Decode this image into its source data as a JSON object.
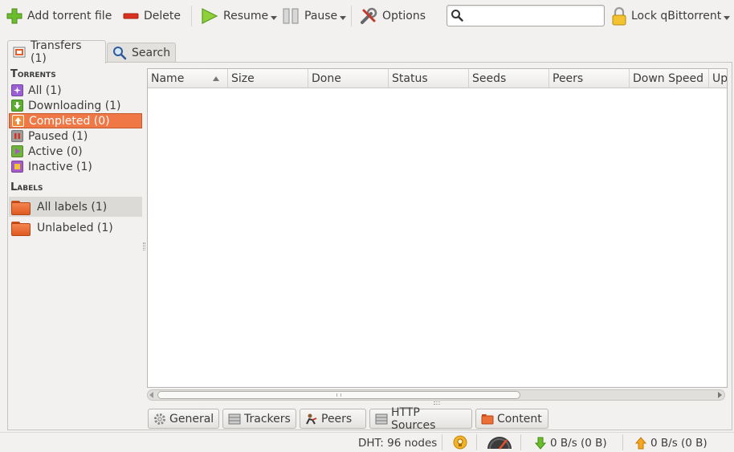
{
  "toolbar": {
    "add_torrent_label": "Add torrent file",
    "delete_label": "Delete",
    "resume_label": "Resume",
    "pause_label": "Pause",
    "options_label": "Options",
    "search_placeholder": "",
    "lock_label": "Lock qBittorrent"
  },
  "tabs": {
    "transfers": "Transfers (1)",
    "search": "Search"
  },
  "sidebar": {
    "torrents_heading": "Torrents",
    "filters": [
      {
        "label": "All (1)",
        "color": "#9b5fd4"
      },
      {
        "label": "Downloading (1)",
        "color": "#5cae2f"
      },
      {
        "label": "Completed (0)",
        "color": "#f08a3a"
      },
      {
        "label": "Paused (1)",
        "color": "#9c9c9c"
      },
      {
        "label": "Active (0)",
        "color": "#6fb33a"
      },
      {
        "label": "Inactive (1)",
        "color": "#a45cc8"
      }
    ],
    "labels_heading": "Labels",
    "labels": [
      {
        "label": "All labels (1)"
      },
      {
        "label": "Unlabeled (1)"
      }
    ]
  },
  "table": {
    "columns": [
      "Name",
      "Size",
      "Done",
      "Status",
      "Seeds",
      "Peers",
      "Down Speed",
      "Up"
    ]
  },
  "detail_tabs": [
    "General",
    "Trackers",
    "Peers",
    "HTTP Sources",
    "Content"
  ],
  "statusbar": {
    "dht": "DHT: 96 nodes",
    "download": "0 B/s (0 B)",
    "upload": "0 B/s (0 B)"
  },
  "colors": {
    "selection": "#f07746",
    "accent_green": "#6cbd2e",
    "delete_red": "#d9311f"
  }
}
